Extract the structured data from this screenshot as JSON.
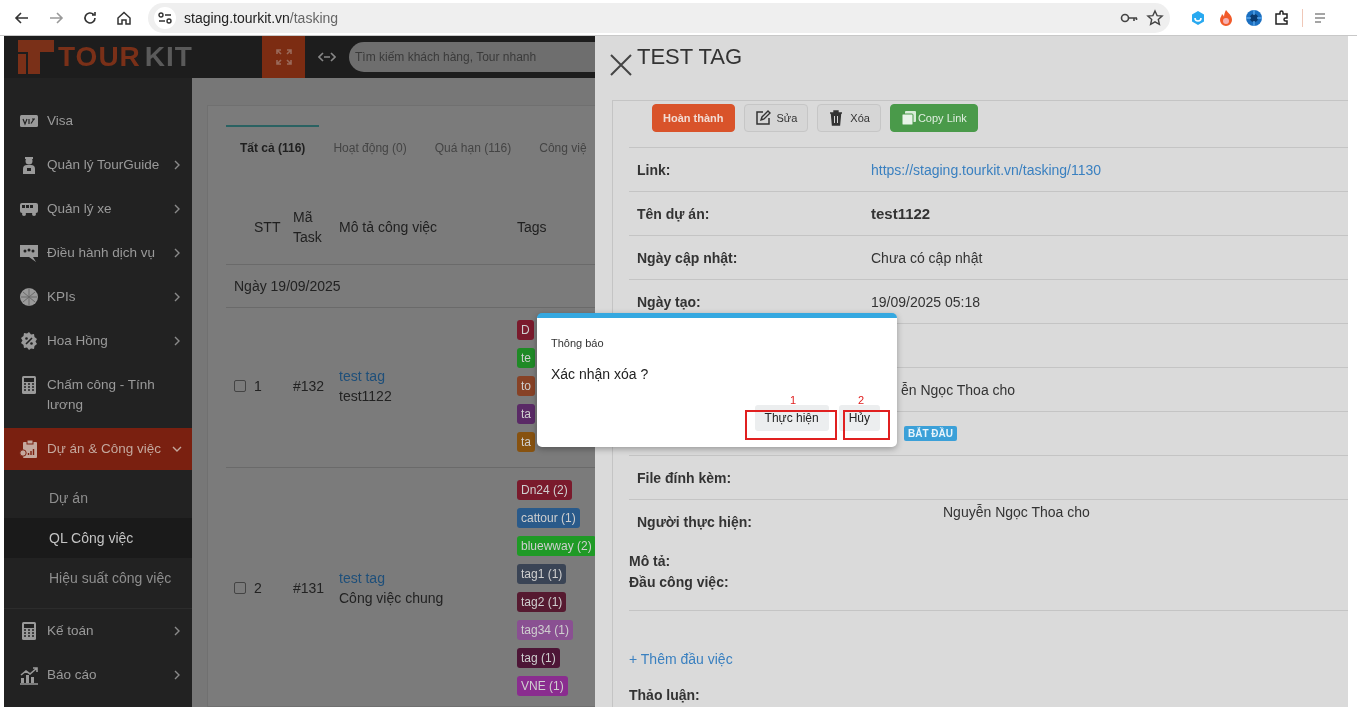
{
  "browser": {
    "url_host": "staging.tourkit.vn",
    "url_path": "/tasking"
  },
  "header": {
    "logo_parts": [
      "TOUR",
      "KIT"
    ],
    "search_placeholder": "Tìm kiếm khách hàng, Tour nhanh"
  },
  "sidebar": {
    "items": [
      {
        "label": "Visa",
        "kind": "visa",
        "has_submenu": false,
        "expanded": false
      },
      {
        "label": "Quản lý TourGuide",
        "kind": "guide",
        "has_submenu": true,
        "expanded": false
      },
      {
        "label": "Quản lý xe",
        "kind": "bus",
        "has_submenu": true,
        "expanded": false
      },
      {
        "label": "Điều hành dịch vụ",
        "kind": "chat",
        "has_submenu": true,
        "expanded": false
      },
      {
        "label": "KPIs",
        "kind": "globe",
        "has_submenu": true,
        "expanded": false
      },
      {
        "label": "Hoa Hồng",
        "kind": "percent",
        "has_submenu": true,
        "expanded": false
      },
      {
        "label": "Chấm công - Tính lương",
        "kind": "calc",
        "has_submenu": false,
        "expanded": false
      },
      {
        "label": "Dự án & Công việc",
        "kind": "clipboard",
        "has_submenu": true,
        "expanded": true,
        "children": [
          {
            "label": "Dự án",
            "selected": false
          },
          {
            "label": "QL Công việc",
            "selected": true
          },
          {
            "label": "Hiệu suất công việc",
            "selected": false
          }
        ]
      },
      {
        "label": "Kế toán",
        "kind": "calc",
        "has_submenu": true,
        "expanded": false
      },
      {
        "label": "Báo cáo",
        "kind": "chart",
        "has_submenu": true,
        "expanded": false
      }
    ]
  },
  "tabs": [
    {
      "label": "Tất cả (116)",
      "selected": true
    },
    {
      "label": "Hoạt động (0)",
      "selected": false
    },
    {
      "label": "Quá hạn (116)",
      "selected": false
    },
    {
      "label": "Công việ",
      "selected": false
    }
  ],
  "table": {
    "columns": [
      "STT",
      "Mã\nTask",
      "Mô tả công việc",
      "Tags"
    ],
    "groups": [
      {
        "label": "Ngày 19/09/2025",
        "rows": [
          {
            "checked": false,
            "stt": "1",
            "code": "#132",
            "title": "test tag",
            "project": "test1122",
            "tags": [
              {
                "label": "D",
                "color": "#7a1a2c"
              },
              {
                "label": "te",
                "color": "#1f8a26"
              },
              {
                "label": "to",
                "color": "#874226"
              },
              {
                "label": "ta",
                "color": "#5a2a66"
              },
              {
                "label": "ta",
                "color": "#875210"
              }
            ]
          },
          {
            "checked": false,
            "stt": "2",
            "code": "#131",
            "title": "test tag",
            "project": "Công việc chung",
            "tags": [
              {
                "label": "Dn24 (2)",
                "color": "#7a1a2c"
              },
              {
                "label": "cattour (1)",
                "color": "#2a5a8a"
              },
              {
                "label": "bluewway (2)",
                "color": "#1f9a26"
              },
              {
                "label": "tag1 (1)",
                "color": "#3a4455"
              },
              {
                "label": "tag2 (1)",
                "color": "#561a30"
              },
              {
                "label": "tag34 (1)",
                "color": "#8a5092"
              },
              {
                "label": "tag (1)",
                "color": "#4d1536"
              },
              {
                "label": "VNE (1)",
                "color": "#8a2d8f"
              }
            ]
          }
        ]
      }
    ]
  },
  "detail": {
    "title": "TEST TAG",
    "actions": [
      {
        "label": "Hoàn thành",
        "kind": "primary"
      },
      {
        "label": "Sửa",
        "kind": "edit"
      },
      {
        "label": "Xóa",
        "kind": "delete"
      },
      {
        "label": "Copy Link",
        "kind": "copy"
      }
    ],
    "fields": [
      {
        "label": "Link:",
        "value": "https://staging.tourkit.vn/tasking/1130",
        "kind": "link"
      },
      {
        "label": "Tên dự án:",
        "value": "test1122",
        "kind": "strong"
      },
      {
        "label": "Ngày cập nhật:",
        "value": "Chưa có cập nhật",
        "kind": "text"
      },
      {
        "label": "Ngày tạo:",
        "value": "19/09/2025 05:18",
        "kind": "text"
      },
      {
        "kind": "covered"
      },
      {
        "value": "ễn Ngọc Thoa cho",
        "kind": "tail"
      },
      {
        "value": "BẮT ĐẦU",
        "kind": "badge"
      },
      {
        "label": "File đính kèm:",
        "kind": "text"
      },
      {
        "label": "Người thực hiện:",
        "value": "Nguyễn Ngọc Thoa cho",
        "kind": "person"
      }
    ],
    "notes": [
      "Mô tả:",
      "Đầu công việc:"
    ],
    "add_link": "+ Thêm đầu việc",
    "discussion": "Thảo luận:"
  },
  "dialog": {
    "title": "Thông báo",
    "message": "Xác nhận xóa ?",
    "buttons": [
      {
        "label": "Thực hiện",
        "marker": "1"
      },
      {
        "label": "Hủy",
        "marker": "2"
      }
    ]
  }
}
